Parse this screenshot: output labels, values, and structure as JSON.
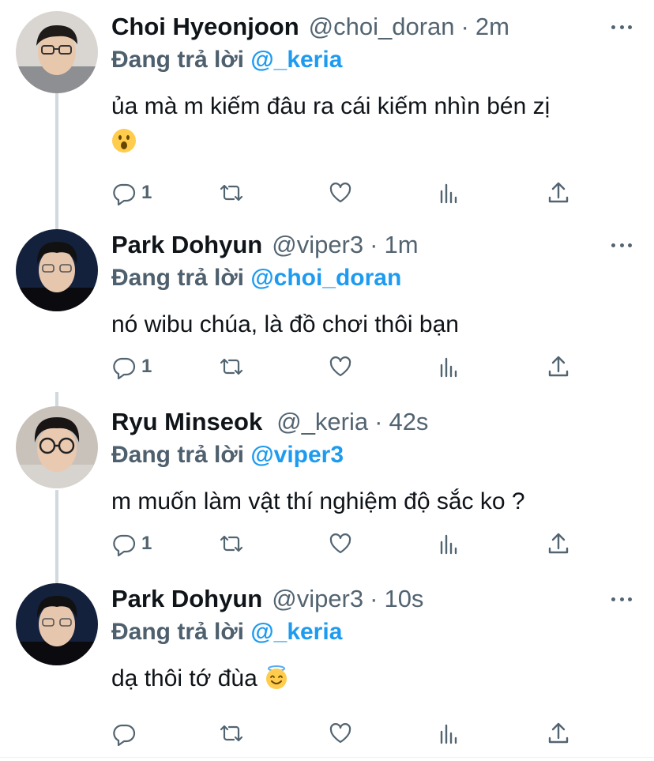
{
  "replying_prefix": "Đang trả lời",
  "colors": {
    "accent": "#1d9bf0",
    "secondary_text": "#536471",
    "thread_line": "#cfd9de"
  },
  "tweets": [
    {
      "display_name": "Choi Hyeonjoon",
      "handle": "@choi_doran",
      "separator": "·",
      "time": "2m",
      "reply_to": "@_keria",
      "text": "ủa mà m kiếm đâu ra cái kiếm nhìn bén zị",
      "emoji": "hushed-face-emoji",
      "reply_count": "1"
    },
    {
      "display_name": "Park Dohyun",
      "handle": "@viper3",
      "separator": "·",
      "time": "1m",
      "reply_to": "@choi_doran",
      "text": "nó wibu chúa, là đồ chơi thôi bạn",
      "reply_count": "1"
    },
    {
      "display_name": "Ryu Minseok",
      "handle": "@_keria",
      "separator": "·",
      "time": "42s",
      "reply_to": "@viper3",
      "text": "m muốn làm vật thí nghiệm độ sắc ko ?",
      "reply_count": "1"
    },
    {
      "display_name": "Park Dohyun",
      "handle": "@viper3",
      "separator": "·",
      "time": "10s",
      "reply_to": "@_keria",
      "text": "dạ thôi tớ đùa",
      "emoji": "smiling-face-with-halo-emoji",
      "reply_count": ""
    }
  ],
  "icons": {
    "reply": "speech-bubble-icon",
    "retweet": "retweet-icon",
    "like": "heart-icon",
    "analytics": "bar-chart-icon",
    "share": "share-upload-icon",
    "more": "more-dots-icon"
  }
}
